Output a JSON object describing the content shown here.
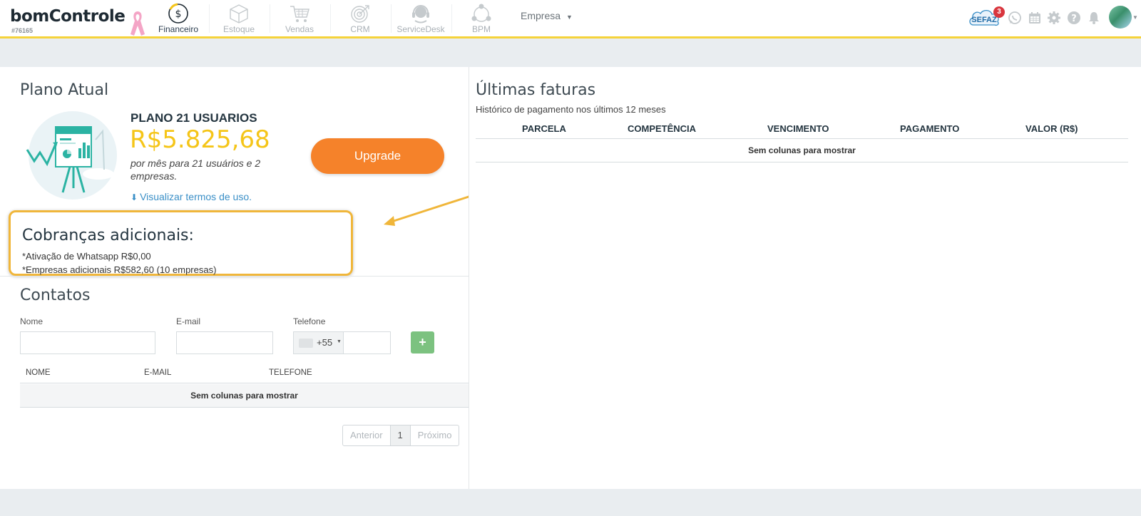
{
  "brand": {
    "logo_text": "bomControle",
    "account_id": "#76165"
  },
  "nav": {
    "items": [
      {
        "label": "Financeiro",
        "icon": "dollar-coin-icon",
        "active": true
      },
      {
        "label": "Estoque",
        "icon": "box-icon",
        "active": false
      },
      {
        "label": "Vendas",
        "icon": "cart-icon",
        "active": false
      },
      {
        "label": "CRM",
        "icon": "target-icon",
        "active": false
      },
      {
        "label": "ServiceDesk",
        "icon": "headset-icon",
        "active": false
      },
      {
        "label": "BPM",
        "icon": "process-icon",
        "active": false
      }
    ],
    "company_label": "Empresa",
    "sefaz_label": "SEFAZ",
    "sefaz_badge": "3"
  },
  "plan": {
    "section_title": "Plano Atual",
    "name": "PLANO 21 USUARIOS",
    "price": "R$5.825,68",
    "description": "por mês para 21 usuários e 2 empresas.",
    "terms_link": "Visualizar termos de uso.",
    "upgrade_label": "Upgrade"
  },
  "extras": {
    "title": "Cobranças adicionais:",
    "lines": [
      "*Ativação de Whatsapp R$0,00",
      "*Empresas adicionais R$582,60 (10 empresas)"
    ]
  },
  "contacts": {
    "title": "Contatos",
    "name_label": "Nome",
    "email_label": "E-mail",
    "phone_label": "Telefone",
    "name_value": "",
    "email_value": "",
    "phone_value": "",
    "phone_ddi": "+55",
    "add_label": "+",
    "columns": [
      "NOME",
      "E-MAIL",
      "TELEFONE"
    ],
    "empty_text": "Sem colunas para mostrar",
    "pager": {
      "prev": "Anterior",
      "page": "1",
      "next": "Próximo"
    }
  },
  "invoices": {
    "title": "Últimas faturas",
    "subtitle": "Histórico de pagamento nos últimos 12 meses",
    "columns": [
      "PARCELA",
      "COMPETÊNCIA",
      "VENCIMENTO",
      "PAGAMENTO",
      "VALOR (R$)"
    ],
    "empty_text": "Sem colunas para mostrar"
  },
  "colors": {
    "accent_yellow": "#f5d33a",
    "price_yellow": "#f5c518",
    "upgrade_orange": "#f5822a",
    "highlight_border": "#f0b63a",
    "link_blue": "#3a8fc7",
    "add_green": "#7cc280",
    "badge_red": "#d9363e"
  }
}
